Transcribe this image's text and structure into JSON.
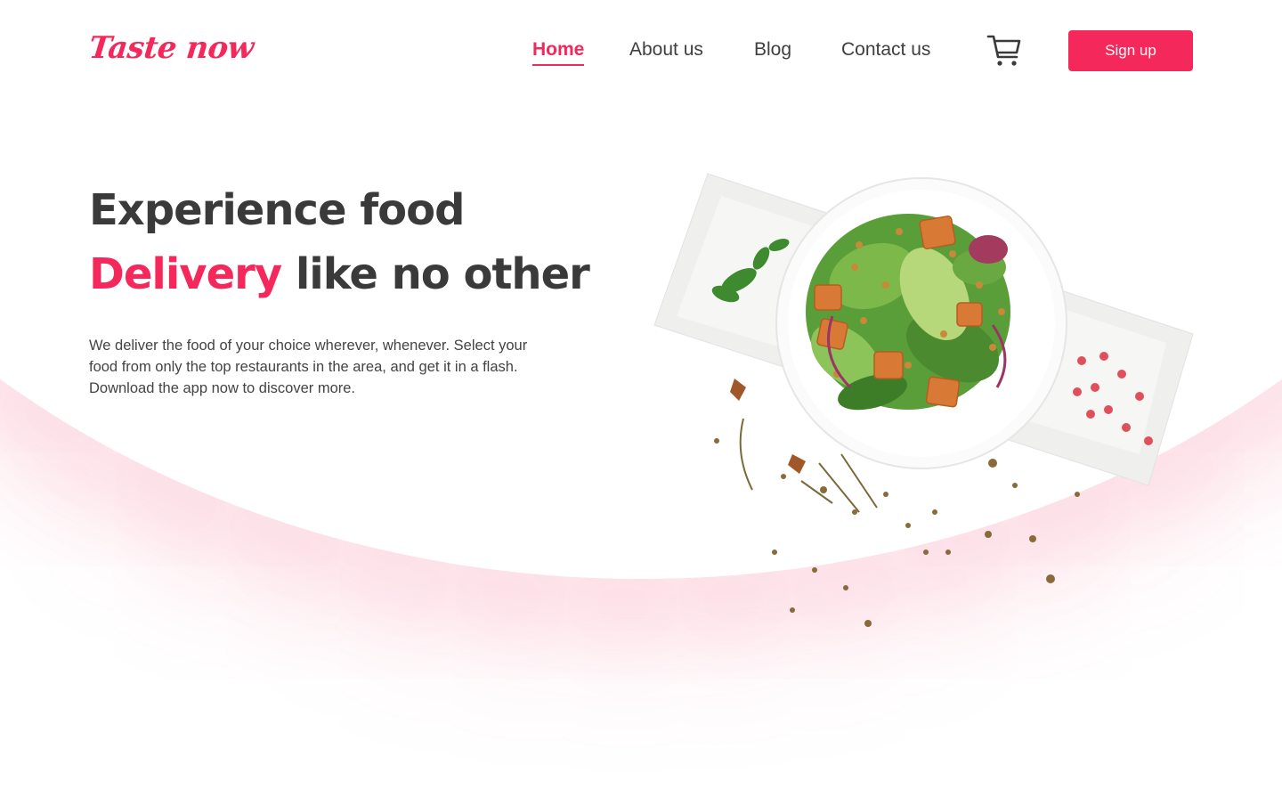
{
  "brand": {
    "logo_text": "Taste now",
    "accent_color": "#f4285a",
    "text_color": "#3a3a3a"
  },
  "nav": {
    "items": [
      {
        "label": "Home",
        "active": true
      },
      {
        "label": "About us",
        "active": false
      },
      {
        "label": "Blog",
        "active": false
      },
      {
        "label": "Contact us",
        "active": false
      }
    ],
    "cart_icon": "shopping-cart-icon",
    "signup_label": "Sign up"
  },
  "hero": {
    "line1": "Experience food",
    "line2_accent": "Delivery",
    "line2_rest": " like no other",
    "description": "We deliver the food of your choice wherever, whenever. Select your food from only the top restaurants in the area, and get it in a flash. Download the app now to discover more."
  },
  "illustration": {
    "icon": "salad-bowl-image"
  }
}
